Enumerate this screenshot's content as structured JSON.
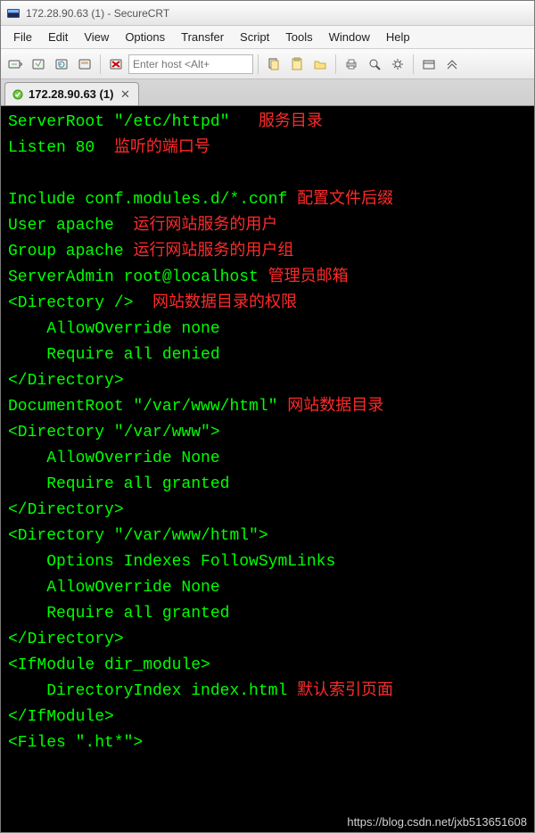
{
  "title": "172.28.90.63 (1) - SecureCRT",
  "menu": [
    "File",
    "Edit",
    "View",
    "Options",
    "Transfer",
    "Script",
    "Tools",
    "Window",
    "Help"
  ],
  "host_placeholder": "Enter host <Alt+",
  "tab": {
    "label": "172.28.90.63 (1)",
    "close": "✕"
  },
  "watermark": "https://blog.csdn.net/jxb513651608",
  "lines": [
    [
      [
        "g",
        "ServerRoot \"/etc/httpd\"   "
      ],
      [
        "r",
        "服务目录"
      ]
    ],
    [
      [
        "g",
        "Listen 80  "
      ],
      [
        "r",
        "监听的端口号"
      ]
    ],
    [
      [
        "g",
        " "
      ]
    ],
    [
      [
        "g",
        "Include conf.modules.d/*.conf "
      ],
      [
        "r",
        "配置文件后缀"
      ]
    ],
    [
      [
        "g",
        "User apache  "
      ],
      [
        "r",
        "运行网站服务的用户"
      ]
    ],
    [
      [
        "g",
        "Group apache "
      ],
      [
        "r",
        "运行网站服务的用户组"
      ]
    ],
    [
      [
        "g",
        "ServerAdmin root@localhost "
      ],
      [
        "r",
        "管理员邮箱"
      ]
    ],
    [
      [
        "g",
        "<Directory />  "
      ],
      [
        "r",
        "网站数据目录的权限"
      ]
    ],
    [
      [
        "g",
        "    AllowOverride none"
      ]
    ],
    [
      [
        "g",
        "    Require all denied"
      ]
    ],
    [
      [
        "g",
        "</Directory>"
      ]
    ],
    [
      [
        "g",
        "DocumentRoot \"/var/www/html\" "
      ],
      [
        "r",
        "网站数据目录"
      ]
    ],
    [
      [
        "g",
        "<Directory \"/var/www\">"
      ]
    ],
    [
      [
        "g",
        "    AllowOverride None"
      ]
    ],
    [
      [
        "g",
        "    Require all granted"
      ]
    ],
    [
      [
        "g",
        "</Directory>"
      ]
    ],
    [
      [
        "g",
        "<Directory \"/var/www/html\">"
      ]
    ],
    [
      [
        "g",
        "    Options Indexes FollowSymLinks"
      ]
    ],
    [
      [
        "g",
        "    AllowOverride None"
      ]
    ],
    [
      [
        "g",
        "    Require all granted"
      ]
    ],
    [
      [
        "g",
        "</Directory>"
      ]
    ],
    [
      [
        "g",
        "<IfModule dir_module>"
      ]
    ],
    [
      [
        "g",
        "    DirectoryIndex index.html "
      ],
      [
        "r",
        "默认索引页面"
      ]
    ],
    [
      [
        "g",
        "</IfModule>"
      ]
    ],
    [
      [
        "g",
        "<Files \".ht*\">"
      ]
    ]
  ]
}
